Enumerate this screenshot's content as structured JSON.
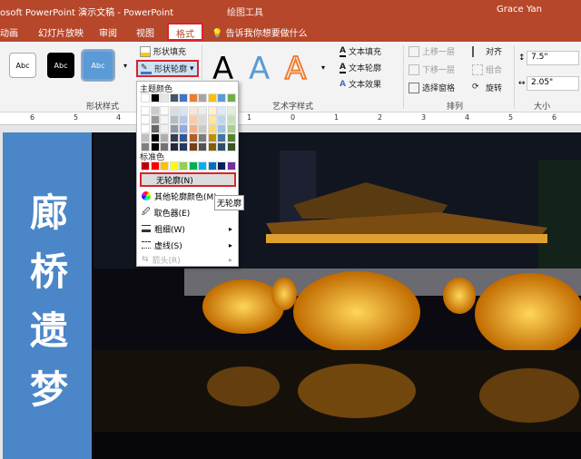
{
  "titlebar": {
    "title": "osoft PowerPoint 演示文稿 - PowerPoint",
    "tool": "绘图工具",
    "user": "Grace Yan"
  },
  "tabs": [
    {
      "label": "动画"
    },
    {
      "label": "幻灯片放映"
    },
    {
      "label": "审阅"
    },
    {
      "label": "视图"
    },
    {
      "label": "格式"
    }
  ],
  "tellme": "告诉我你想要做什么",
  "ribbon": {
    "shape_styles": [
      "Abc",
      "Abc",
      "Abc"
    ],
    "shape_fill": "形状填充",
    "shape_outline": "形状轮廓",
    "wordart_letters": [
      "A",
      "A",
      "A"
    ],
    "text_fill": "文本填充",
    "text_outline": "文本轮廓",
    "text_effects": "文本效果",
    "bring_forward": "上移一层",
    "send_backward": "下移一层",
    "selection_pane": "选择窗格",
    "align": "对齐",
    "group": "组合",
    "rotate": "旋转",
    "height": "7.5\"",
    "width": "2.05\"",
    "groups": {
      "shape_styles": "形状样式",
      "wordart": "艺术字样式",
      "arrange": "排列",
      "size": "大小"
    }
  },
  "ruler": [
    "6",
    "5",
    "4",
    "3",
    "2",
    "1",
    "0",
    "1",
    "2",
    "3",
    "4",
    "5",
    "6"
  ],
  "menu": {
    "theme_colors": "主题颜色",
    "standard_colors": "标准色",
    "no_outline": "无轮廓(N)",
    "more_colors": "其他轮廓颜色(M)...",
    "eyedropper": "取色器(E)",
    "weight": "粗细(W)",
    "dashes": "虚线(S)",
    "arrows": "箭头(R)"
  },
  "tooltip": "无轮廓",
  "slide": {
    "vertical_text": [
      "廊",
      "桥",
      "遗",
      "梦"
    ]
  },
  "colors": {
    "theme_top": [
      "#ffffff",
      "#000000",
      "#e7e6e6",
      "#44546a",
      "#4472c4",
      "#ed7d31",
      "#a5a5a5",
      "#ffc000",
      "#5b9bd5",
      "#70ad47"
    ],
    "standard": [
      "#c00000",
      "#ff0000",
      "#ffc000",
      "#ffff00",
      "#92d050",
      "#00b050",
      "#00b0f0",
      "#0070c0",
      "#002060",
      "#7030a0"
    ],
    "accent": "#b7472a"
  }
}
